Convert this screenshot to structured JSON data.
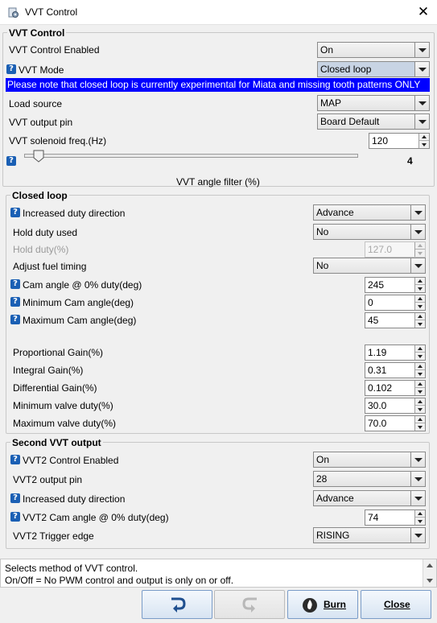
{
  "window": {
    "title": "VVT Control",
    "close_glyph": "✕"
  },
  "vvt_group": {
    "title": "VVT Control",
    "rows": {
      "enabled": {
        "label": "VVT Control Enabled",
        "value": "On"
      },
      "mode": {
        "label": "VVT Mode",
        "value": "Closed loop"
      },
      "load_source": {
        "label": "Load source",
        "value": "MAP"
      },
      "output_pin": {
        "label": "VVT output pin",
        "value": "Board Default"
      },
      "solenoid_freq": {
        "label": "VVT solenoid freq.(Hz)",
        "value": "120"
      }
    },
    "notice": "Please note that closed loop is currently experimental for Miata and missing tooth patterns ONLY",
    "slider": {
      "label": "VVT angle filter (%)",
      "value": "4",
      "fraction": 0.04
    }
  },
  "closed_loop": {
    "title": "Closed loop",
    "increased_duty_direction": {
      "label": "Increased duty direction",
      "value": "Advance"
    },
    "hold_duty_used": {
      "label": "Hold duty used",
      "value": "No"
    },
    "hold_duty": {
      "label": "Hold duty(%)",
      "value": "127.0"
    },
    "adjust_fuel_timing": {
      "label": "Adjust fuel timing",
      "value": "No"
    },
    "cam_angle_0": {
      "label": "Cam angle @ 0% duty(deg)",
      "value": "245"
    },
    "min_cam_angle": {
      "label": "Minimum Cam angle(deg)",
      "value": "0"
    },
    "max_cam_angle": {
      "label": "Maximum Cam angle(deg)",
      "value": "45"
    },
    "p_gain": {
      "label": "Proportional Gain(%)",
      "value": "1.19"
    },
    "i_gain": {
      "label": "Integral Gain(%)",
      "value": "0.31"
    },
    "d_gain": {
      "label": "Differential Gain(%)",
      "value": "0.102"
    },
    "min_valve_duty": {
      "label": "Minimum valve duty(%)",
      "value": "30.0"
    },
    "max_valve_duty": {
      "label": "Maximum valve duty(%)",
      "value": "70.0"
    }
  },
  "second_vvt": {
    "title": "Second VVT output",
    "enabled": {
      "label": "VVT2 Control Enabled",
      "value": "On"
    },
    "output_pin": {
      "label": "VVT2 output pin",
      "value": "28"
    },
    "direction": {
      "label": "Increased duty direction",
      "value": "Advance"
    },
    "cam_angle_0": {
      "label": "VVT2 Cam angle @ 0% duty(deg)",
      "value": "74"
    },
    "trigger_edge": {
      "label": "VVT2 Trigger edge",
      "value": "RISING"
    }
  },
  "help_glyph": "?",
  "description": {
    "line1": "Selects method of VVT control.",
    "line2": "On/Off = No PWM control and output is only on or off."
  },
  "buttons": {
    "burn": "Burn",
    "close": "Close"
  },
  "icons": {
    "undo": "undo-arrow-icon",
    "redo": "redo-arrow-icon",
    "burn": "burn-flame-icon",
    "help": "help-icon"
  },
  "colors": {
    "notice_bg": "#0000ff",
    "help_icon": "#1a5fb4",
    "button_border": "#7a9cc8"
  }
}
